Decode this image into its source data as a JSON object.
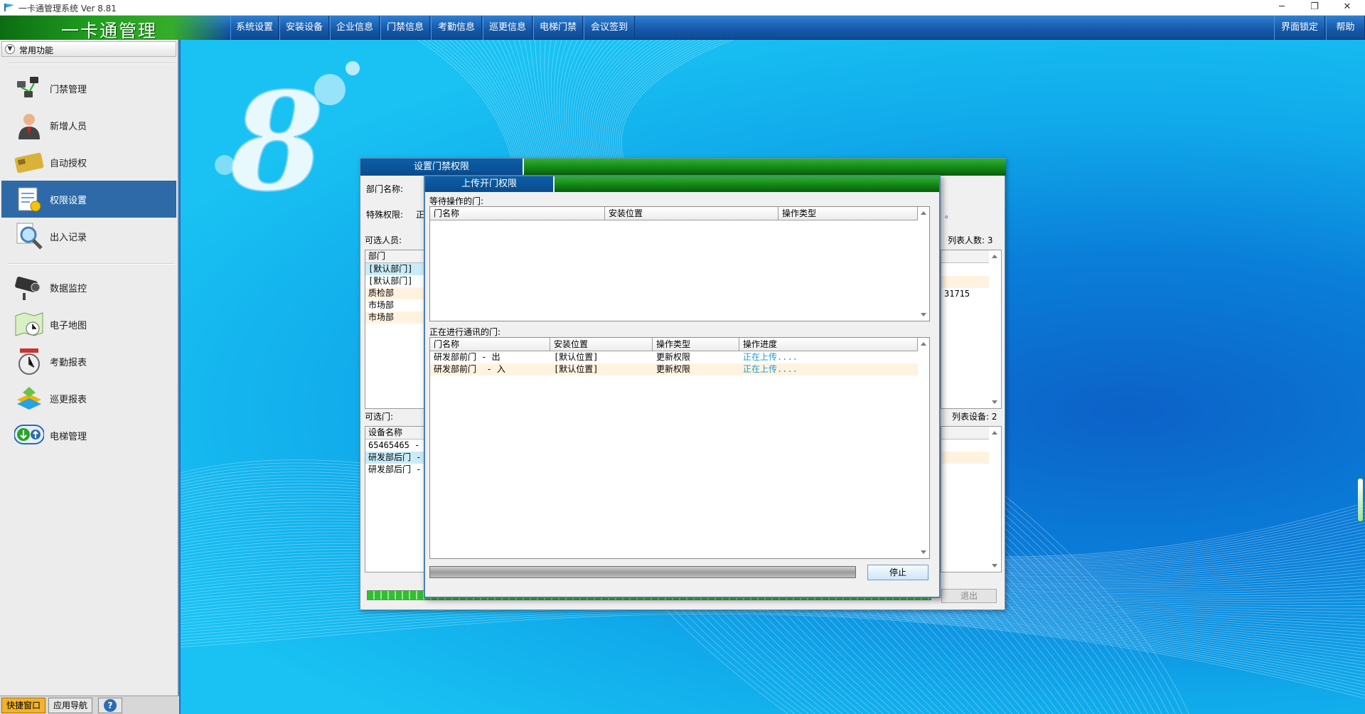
{
  "window": {
    "title": "一卡通管理系统  Ver 8.81",
    "minimize": "─",
    "maximize": "❐",
    "close": "✕"
  },
  "menubar": {
    "brand": "一卡通管理",
    "items": [
      "系统设置",
      "安装设备",
      "企业信息",
      "门禁信息",
      "考勤信息",
      "巡更信息",
      "电梯门禁",
      "会议签到"
    ],
    "right_items": [
      "界面锁定",
      "帮助"
    ]
  },
  "sidebar": {
    "header": "常用功能",
    "toggle": "▼",
    "items": [
      {
        "label": "门禁管理",
        "icon": "door-access-icon"
      },
      {
        "label": "新增人员",
        "icon": "person-icon"
      },
      {
        "label": "自动授权",
        "icon": "card-icon"
      },
      {
        "label": "权限设置",
        "icon": "permission-icon"
      },
      {
        "label": "出入记录",
        "icon": "magnifier-icon"
      },
      {
        "label": "数据监控",
        "icon": "camera-icon"
      },
      {
        "label": "电子地图",
        "icon": "map-icon"
      },
      {
        "label": "考勤报表",
        "icon": "clock-icon"
      },
      {
        "label": "巡更报表",
        "icon": "patrol-icon"
      },
      {
        "label": "电梯管理",
        "icon": "elevator-icon"
      }
    ],
    "active_index": 3,
    "bottom_tabs": [
      "快捷窗口",
      "应用导航",
      "?"
    ]
  },
  "outer_dialog": {
    "title": "设置门禁权限",
    "dept_label": "部门名称:",
    "special_label": "特殊权限:",
    "special_value": "正",
    "people_label": "可选人员:",
    "people_count": "列表人数: 3",
    "people_columns": [
      "部门"
    ],
    "people_rows": [
      "[默认部门]",
      "[默认部门]",
      "质检部",
      "市场部",
      "市场部"
    ],
    "people_extra": "31715",
    "doors_label": "可选门:",
    "doors_count": "列表设备: 2",
    "doors_columns": [
      "设备名称"
    ],
    "doors_rows": [
      "65465465 -",
      "研发部后门 -",
      "研发部后门 -"
    ],
    "note_mark": "。",
    "exit_label": "退出"
  },
  "upload_dialog": {
    "title": "上传开门权限",
    "waiting_label": "等待操作的门:",
    "waiting_columns": [
      "门名称",
      "安装位置",
      "操作类型"
    ],
    "active_label": "正在进行通讯的门:",
    "active_columns": [
      "门名称",
      "安装位置",
      "操作类型",
      "操作进度"
    ],
    "active_rows": [
      {
        "door": "研发部前门 - 出",
        "location": "[默认位置]",
        "op": "更新权限",
        "progress": "正在上传...."
      },
      {
        "door": "研发部前门  - 入",
        "location": "[默认位置]",
        "op": "更新权限",
        "progress": "正在上传...."
      }
    ],
    "stop_label": "停止"
  },
  "colors": {
    "menubar": "#1558a8",
    "active_sidebar": "#2e6aa8",
    "progress_text": "#1e9bd6"
  }
}
